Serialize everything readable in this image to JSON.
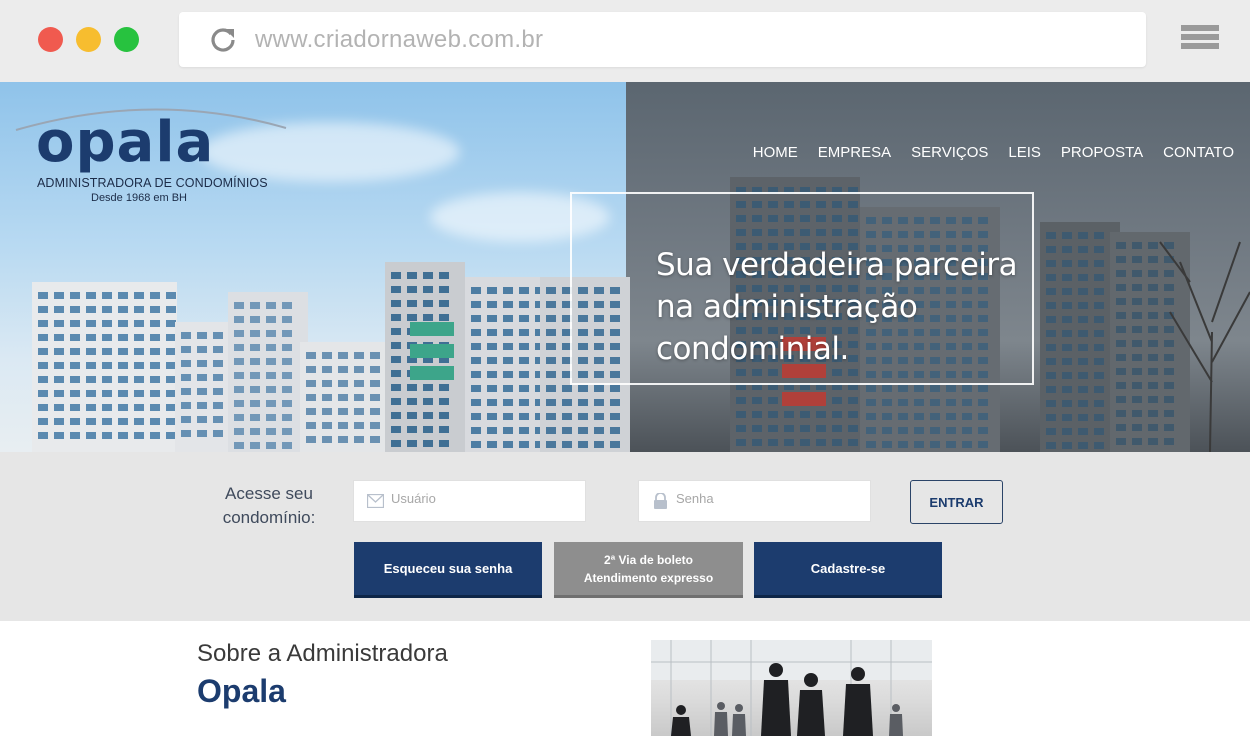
{
  "browser": {
    "url": "www.criadornaweb.com.br"
  },
  "site": {
    "logo_word": "opala",
    "logo_subtitle": "ADMINISTRADORA DE CONDOMÍNIOS",
    "logo_since": "Desde 1968 em BH",
    "nav": [
      "HOME",
      "EMPRESA",
      "SERVIÇOS",
      "LEIS",
      "PROPOSTA",
      "CONTATO"
    ],
    "tagline": "Sua verdadeira parceira na administração condominial."
  },
  "login": {
    "label": "Acesse seu condomínio:",
    "user_placeholder": "Usuário",
    "pass_placeholder": "Senha",
    "enter_label": "ENTRAR",
    "forgot_label": "Esqueceu sua senha",
    "boleto_line1": "2ª Via de boleto",
    "boleto_line2": "Atendimento expresso",
    "signup_label": "Cadastre-se"
  },
  "about": {
    "title": "Sobre a Administradora",
    "name": "Opala"
  },
  "colors": {
    "brand_blue": "#1c3c6e",
    "button_gray": "#8e8e8e",
    "login_band": "#e6e6e6"
  }
}
